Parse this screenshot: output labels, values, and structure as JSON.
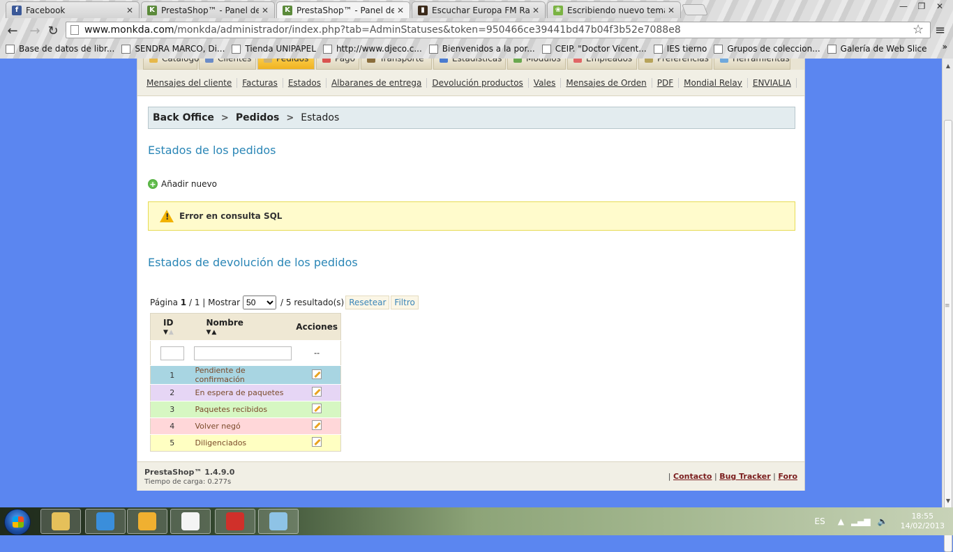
{
  "browser": {
    "tabs": [
      {
        "label": "Facebook",
        "color": "#3b5998",
        "glyph": "f",
        "active": false
      },
      {
        "label": "PrestaShop™ - Panel de ad",
        "color": "#5b8a3a",
        "glyph": "K",
        "active": false
      },
      {
        "label": "PrestaShop™ - Panel de a",
        "color": "#5b8a3a",
        "glyph": "K",
        "active": true
      },
      {
        "label": "Escuchar Europa FM Radio",
        "color": "#3b2a1a",
        "glyph": "▮",
        "active": false
      },
      {
        "label": "Escribiendo nuevo tema -",
        "color": "#7ab342",
        "glyph": "❀",
        "active": false
      }
    ],
    "url_domain": "www.monkda.com",
    "url_path": "/monkda/administrador/index.php?tab=AdminStatuses&token=950466ce39441bd47b04f3b52e7088e8",
    "bookmarks": [
      "Base de datos de libr...",
      "SENDRA MARCO, Di...",
      "Tienda UNIPAPEL",
      "http://www.djeco.c...",
      "Bienvenidos a la por...",
      "CEIP. \"Doctor Vicent...",
      "IES tierno",
      "Grupos de coleccion...",
      "Galería de Web Slice"
    ],
    "bookmarks_more": "»"
  },
  "admin": {
    "main_tabs": [
      {
        "label": "Catálogo",
        "color": "#e6b84a"
      },
      {
        "label": "Clientes",
        "color": "#6b8cc7"
      },
      {
        "label": "Pedidos",
        "color": "#c9b27a"
      },
      {
        "label": "Pago",
        "color": "#d9534f"
      },
      {
        "label": "Transporte",
        "color": "#8a6d3b"
      },
      {
        "label": "Estadísticas",
        "color": "#4a7bd0"
      },
      {
        "label": "Módulos",
        "color": "#6aa84f"
      },
      {
        "label": "Empleados",
        "color": "#e06666"
      },
      {
        "label": "Preferencias",
        "color": "#b7a35a"
      },
      {
        "label": "Herramientas",
        "color": "#6fa8dc"
      }
    ],
    "active_tab": "Pedidos",
    "sub_tabs": [
      "Mensajes del cliente",
      "Facturas",
      "Estados",
      "Albaranes de entrega",
      "Devolución productos",
      "Vales",
      "Mensajes de Orden",
      "PDF",
      "Mondial Relay",
      "ENVIALIA"
    ],
    "breadcrumb": [
      "Back Office",
      "Pedidos",
      "Estados"
    ],
    "section1_title": "Estados de los pedidos",
    "add_new": "Añadir nuevo",
    "error_text": "Error en consulta SQL",
    "section2_title": "Estados de devolución de los pedidos",
    "pager": {
      "page_label": "Página",
      "page_current": "1",
      "page_total": "/ 1 | Mostrar",
      "show_value": "50",
      "results": "/ 5 resultado(s)",
      "reset": "Resetear",
      "filter": "Filtro"
    },
    "table": {
      "headers": {
        "id": "ID",
        "name": "Nombre",
        "actions": "Acciones"
      },
      "filter_placeholder": "--",
      "rows": [
        {
          "id": "1",
          "name": "Pendiente de confirmación",
          "color": "#a8d5e2"
        },
        {
          "id": "2",
          "name": "En espera de paquetes",
          "color": "#e6d6f5"
        },
        {
          "id": "3",
          "name": "Paquetes recibidos",
          "color": "#d6f7c2"
        },
        {
          "id": "4",
          "name": "Volver negó",
          "color": "#ffd7d9"
        },
        {
          "id": "5",
          "name": "Diligenciados",
          "color": "#ffffc2"
        }
      ]
    },
    "footer": {
      "brand": "PrestaShop™ 1.4.9.0",
      "load_time": "Tiempo de carga: 0.277s",
      "links": [
        "Contacto",
        "Bug Tracker",
        "Foro"
      ]
    }
  },
  "taskbar": {
    "lang": "ES",
    "time": "18:55",
    "date": "14/02/2013",
    "apps": [
      {
        "name": "explorer",
        "color": "#e5c05a"
      },
      {
        "name": "chrome",
        "color": "#3a8edb"
      },
      {
        "name": "outlook",
        "color": "#f0b030"
      },
      {
        "name": "documents",
        "color": "#f4f4f4"
      },
      {
        "name": "media",
        "color": "#d0302a"
      },
      {
        "name": "paint",
        "color": "#8ec3e6"
      }
    ]
  }
}
